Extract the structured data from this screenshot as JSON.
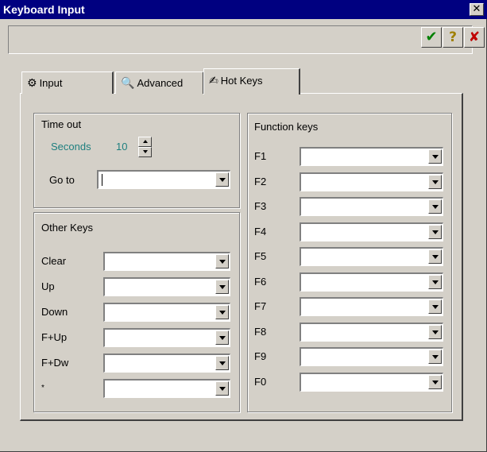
{
  "window": {
    "title": "Keyboard Input",
    "close_glyph": "✕"
  },
  "toolbar": {
    "ok": {
      "glyph": "✔",
      "icon": "checkmark-icon"
    },
    "help": {
      "glyph": "?",
      "icon": "question-icon"
    },
    "cancel": {
      "glyph": "✘",
      "icon": "cross-icon"
    }
  },
  "tabs": [
    {
      "label": "Input",
      "icon": "⚙",
      "icon_name": "gears-icon"
    },
    {
      "label": "Advanced",
      "icon": "🔍",
      "icon_name": "magnifier-icon"
    },
    {
      "label": "Hot Keys",
      "icon": "✍",
      "icon_name": "pen-icon",
      "active": true
    }
  ],
  "timeout": {
    "title": "Time out",
    "seconds_label": "Seconds",
    "seconds_value": "10",
    "goto_label": "Go to",
    "goto_value": ""
  },
  "other_keys": {
    "title": "Other Keys",
    "items": [
      {
        "label": "Clear",
        "value": ""
      },
      {
        "label": "Up",
        "value": ""
      },
      {
        "label": "Down",
        "value": ""
      },
      {
        "label": "F+Up",
        "value": ""
      },
      {
        "label": "F+Dw",
        "value": ""
      },
      {
        "label": "*",
        "value": ""
      }
    ]
  },
  "function_keys": {
    "title": "Function keys",
    "items": [
      {
        "label": "F1",
        "value": ""
      },
      {
        "label": "F2",
        "value": ""
      },
      {
        "label": "F3",
        "value": ""
      },
      {
        "label": "F4",
        "value": ""
      },
      {
        "label": "F5",
        "value": ""
      },
      {
        "label": "F6",
        "value": ""
      },
      {
        "label": "F7",
        "value": ""
      },
      {
        "label": "F8",
        "value": ""
      },
      {
        "label": "F9",
        "value": ""
      },
      {
        "label": "F0",
        "value": ""
      }
    ]
  },
  "colors": {
    "title_bar": "#000080",
    "face": "#d4d0c8",
    "label_teal": "#1e7f7f"
  }
}
